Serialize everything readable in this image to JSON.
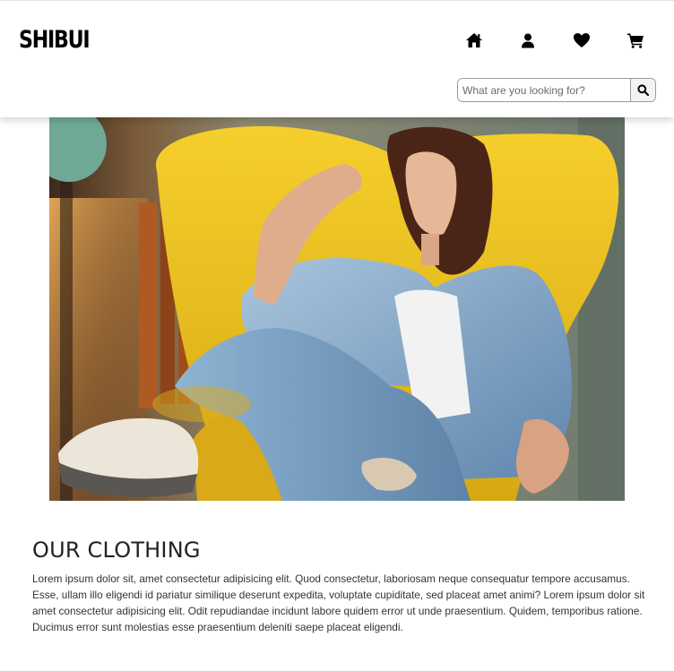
{
  "header": {
    "logo": "SHIBUI",
    "nav": [
      "home-icon",
      "user-icon",
      "heart-icon",
      "cart-icon"
    ],
    "search": {
      "placeholder": "What are you looking for?",
      "button_icon": "search-icon"
    }
  },
  "hero": {
    "image": "woman in denim jacket on yellow chair"
  },
  "section": {
    "title": "OUR CLOTHING",
    "body": "Lorem ipsum dolor sit, amet consectetur adipisicing elit. Quod consectetur, laboriosam neque consequatur tempore accusamus. Esse, ullam illo eligendi id pariatur similique deserunt expedita, voluptate cupiditate, sed placeat amet animi? Lorem ipsum dolor sit amet consectetur adipisicing elit. Odit repudiandae incidunt labore quidem error ut unde praesentium. Quidem, temporibus ratione. Ducimus error sunt molestias esse praesentium deleniti saepe placeat eligendi."
  },
  "colors": {
    "header_bg": "#ffffff",
    "chair_yellow": "#f2c41d",
    "denim": "#7aa3c6",
    "text": "#222222"
  }
}
